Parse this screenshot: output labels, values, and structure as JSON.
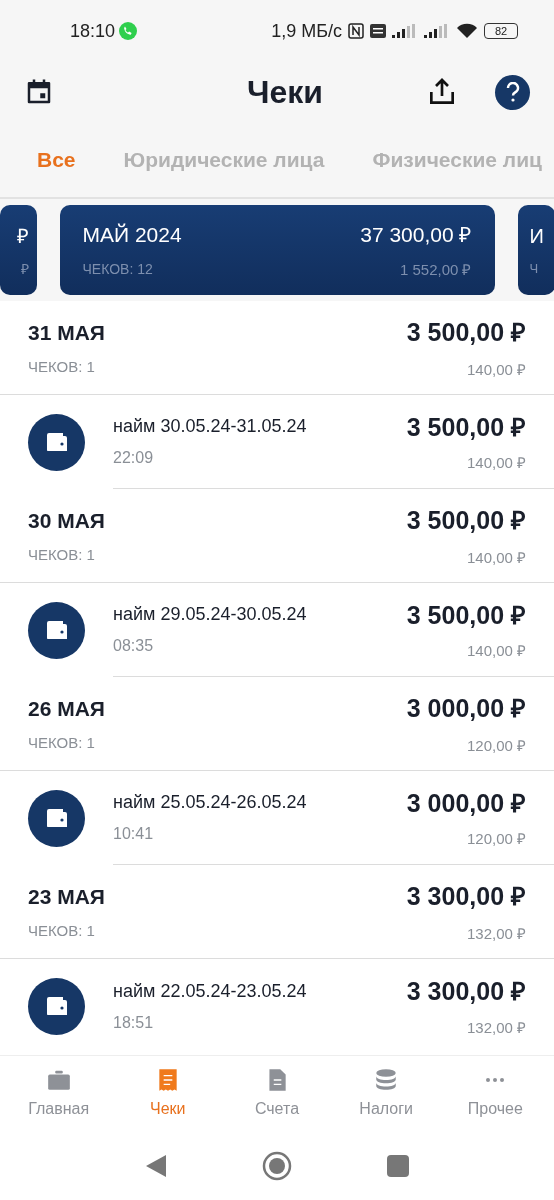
{
  "status_bar": {
    "time": "18:10",
    "speed": "1,9 МБ/с",
    "battery": "82"
  },
  "header": {
    "title": "Чеки"
  },
  "tabs": [
    {
      "label": "Все",
      "selected": true
    },
    {
      "label": "Юридические лица",
      "selected": false
    },
    {
      "label": "Физические лиц",
      "selected": false
    }
  ],
  "month_cards": [
    {
      "title": "₽",
      "subtitle": "₽",
      "kind": "left"
    },
    {
      "title": "МАЙ 2024",
      "subtitle": "ЧЕКОВ: 12",
      "amount": "37 300,00 ₽",
      "tax": "1 552,00 ₽",
      "kind": "center"
    },
    {
      "title": "И",
      "subtitle": "Ч",
      "kind": "right"
    }
  ],
  "rows": [
    {
      "kind": "day",
      "title": "31 МАЯ",
      "subtitle": "ЧЕКОВ: 1",
      "amount": "3 500,00 ₽",
      "tax": "140,00 ₽"
    },
    {
      "kind": "receipt",
      "title": "найм 30.05.24-31.05.24",
      "subtitle": "22:09",
      "amount": "3 500,00 ₽",
      "tax": "140,00 ₽"
    },
    {
      "kind": "day",
      "title": "30 МАЯ",
      "subtitle": "ЧЕКОВ: 1",
      "amount": "3 500,00 ₽",
      "tax": "140,00 ₽"
    },
    {
      "kind": "receipt",
      "title": "найм 29.05.24-30.05.24",
      "subtitle": "08:35",
      "amount": "3 500,00 ₽",
      "tax": "140,00 ₽"
    },
    {
      "kind": "day",
      "title": "26 МАЯ",
      "subtitle": "ЧЕКОВ: 1",
      "amount": "3 000,00 ₽",
      "tax": "120,00 ₽"
    },
    {
      "kind": "receipt",
      "title": "найм 25.05.24-26.05.24",
      "subtitle": "10:41",
      "amount": "3 000,00 ₽",
      "tax": "120,00 ₽"
    },
    {
      "kind": "day",
      "title": "23 МАЯ",
      "subtitle": "ЧЕКОВ: 1",
      "amount": "3 300,00 ₽",
      "tax": "132,00 ₽"
    },
    {
      "kind": "receipt",
      "title": "найм 22.05.24-23.05.24",
      "subtitle": "18:51",
      "amount": "3 300,00 ₽",
      "tax": "132,00 ₽"
    }
  ],
  "bottom_nav": [
    {
      "label": "Главная",
      "kind": "briefcase",
      "selected": false
    },
    {
      "label": "Чеки",
      "kind": "receipt",
      "selected": true
    },
    {
      "label": "Счета",
      "kind": "document",
      "selected": false
    },
    {
      "label": "Налоги",
      "kind": "coins",
      "selected": false
    },
    {
      "label": "Прочее",
      "kind": "more",
      "selected": false
    }
  ]
}
